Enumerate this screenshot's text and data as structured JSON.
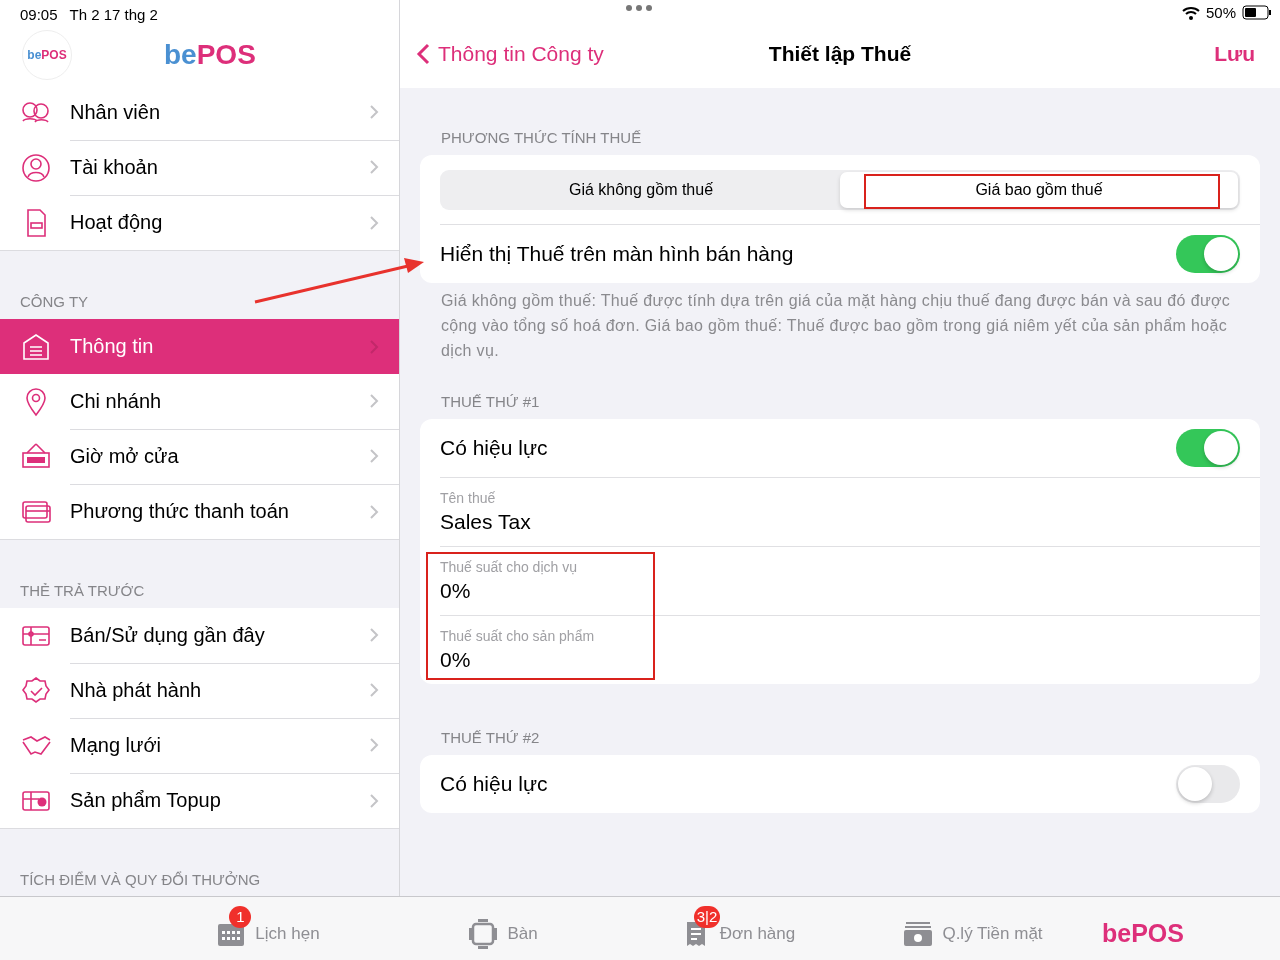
{
  "status_bar": {
    "time": "09:05",
    "date": "Th 2 17 thg 2",
    "battery": "50%"
  },
  "sidebar": {
    "logo_badge": "bePOS",
    "app_title_part1": "be",
    "app_title_part2": "POS",
    "sections": [
      {
        "items": [
          {
            "label": "Nhân viên",
            "selected": false
          },
          {
            "label": "Tài khoản",
            "selected": false
          },
          {
            "label": "Hoạt động",
            "selected": false
          }
        ]
      },
      {
        "header": "CÔNG TY",
        "items": [
          {
            "label": "Thông tin",
            "selected": true
          },
          {
            "label": "Chi nhánh",
            "selected": false
          },
          {
            "label": "Giờ mở cửa",
            "selected": false
          },
          {
            "label": "Phương thức thanh toán",
            "selected": false
          }
        ]
      },
      {
        "header": "THẺ TRẢ TRƯỚC",
        "items": [
          {
            "label": "Bán/Sử dụng gần đây",
            "selected": false
          },
          {
            "label": "Nhà phát hành",
            "selected": false
          },
          {
            "label": "Mạng lưới",
            "selected": false
          },
          {
            "label": "Sản phẩm Topup",
            "selected": false
          }
        ]
      },
      {
        "header": "TÍCH ĐIỂM VÀ QUY ĐỔI THƯỞNG"
      }
    ]
  },
  "nav": {
    "back": "Thông tin Công ty",
    "title": "Thiết lập Thuế",
    "action": "Lưu"
  },
  "method": {
    "header": "PHƯƠNG THỨC TÍNH THUẾ",
    "segments": [
      {
        "label": "Giá không gồm thuế",
        "selected": false
      },
      {
        "label": "Giá bao gồm thuế",
        "selected": true
      }
    ],
    "show_toggle": {
      "label": "Hiển thị Thuế trên màn hình bán hàng",
      "on": true
    },
    "footer": "Giá không gồm thuế: Thuế được tính dựa trên giá của mặt hàng chịu thuế đang được bán và sau đó được cộng vào tổng số hoá đơn. Giá bao gồm thuế: Thuế được bao gồm trong giá niêm yết của sản phẩm hoặc dịch vụ."
  },
  "taxes": [
    {
      "header": "THUẾ THỨ #1",
      "enabled": {
        "label": "Có hiệu lực",
        "on": true
      },
      "fields": [
        {
          "label": "Tên thuế",
          "value": "Sales Tax"
        },
        {
          "label": "Thuế suất cho dịch vụ",
          "value": "0%"
        },
        {
          "label": "Thuế suất cho sản phẩm",
          "value": "0%"
        }
      ]
    },
    {
      "header": "THUẾ THỨ #2",
      "enabled": {
        "label": "Có hiệu lực",
        "on": false
      }
    }
  ],
  "tab_bar": [
    {
      "kind": "calendar",
      "label": "Lịch hẹn",
      "badge": "1"
    },
    {
      "kind": "table",
      "label": "Bàn"
    },
    {
      "kind": "order",
      "label": "Đơn hàng",
      "badge": "3|2"
    },
    {
      "kind": "cash",
      "label": "Q.lý Tiền mặt"
    },
    {
      "kind": "logo",
      "label_part1": "be",
      "label_part2": "POS"
    }
  ]
}
